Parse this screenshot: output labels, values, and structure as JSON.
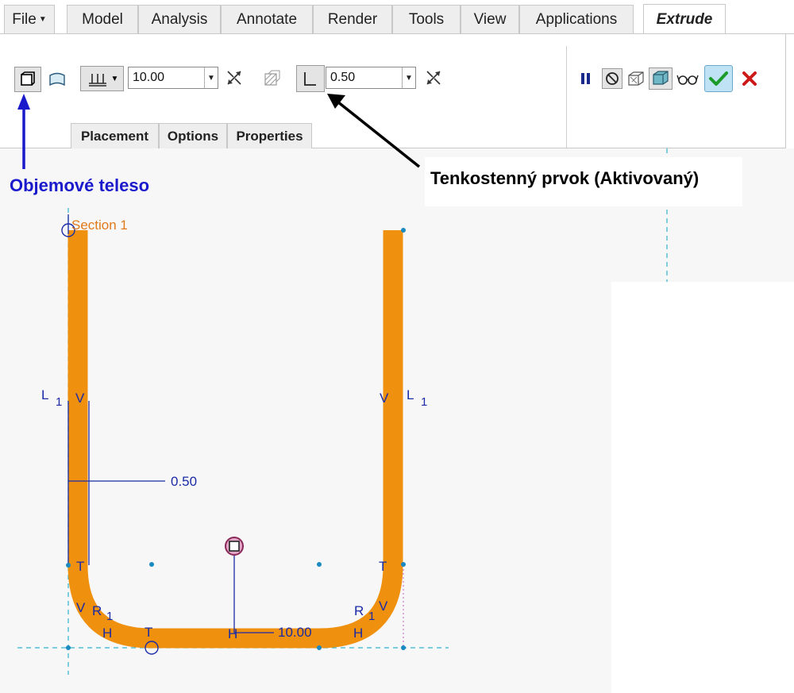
{
  "menu": {
    "file_label": "File",
    "tabs": [
      "Model",
      "Analysis",
      "Annotate",
      "Render",
      "Tools",
      "View",
      "Applications"
    ],
    "active_tab": "Extrude"
  },
  "ribbon": {
    "depth_value": "10.00",
    "thickness_value": "0.50",
    "subtabs": [
      "Placement",
      "Options",
      "Properties"
    ]
  },
  "annotations": {
    "solid_label": "Objemové teleso",
    "thin_label": "Tenkostenný prvok (Aktivovaný)",
    "solid_color": "#1a1acc",
    "thin_color": "#000000"
  },
  "sketch": {
    "section_label": "Section 1",
    "thickness_dim": "0.50",
    "width_dim": "10.00",
    "profile_color": "#f0900f",
    "dimension_color": "#1a2ba6",
    "constraints": {
      "L": "L",
      "one": "1",
      "V": "V",
      "T": "T",
      "R": "R",
      "H": "H"
    }
  },
  "icons": [
    "solid-icon",
    "surface-icon",
    "depth-options-icon",
    "flip-direction-icon",
    "remove-material-icon",
    "thicken-sketch-icon",
    "pause-icon",
    "no-preview-icon",
    "preview-icon",
    "verify-icon",
    "glasses-icon",
    "ok-check-icon",
    "cancel-x-icon"
  ]
}
